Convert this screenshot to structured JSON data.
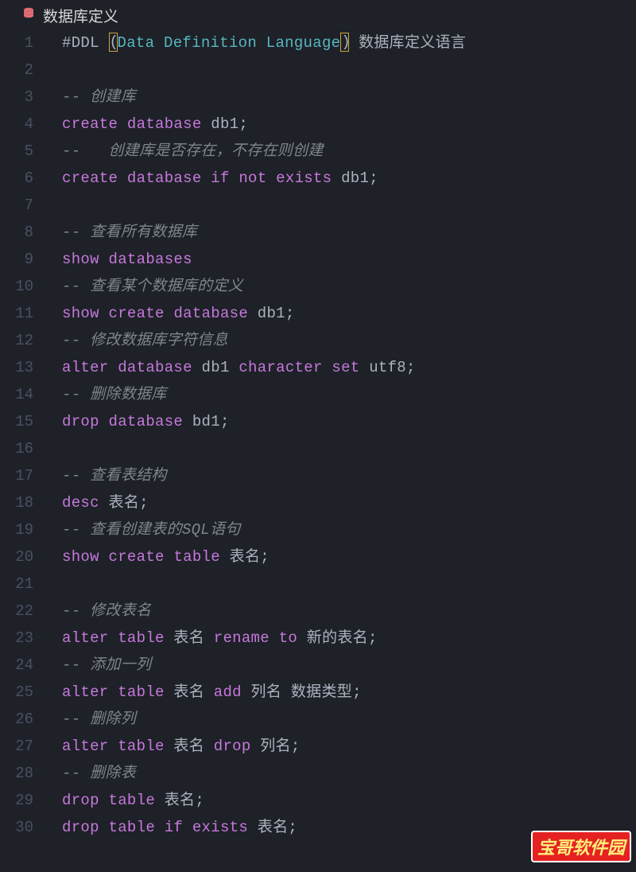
{
  "header": {
    "title": "数据库定义"
  },
  "watermark": "宝哥软件园",
  "colors": {
    "keyword": "#c678dd",
    "cyan": "#56b6c2",
    "comment": "#7f848e",
    "text": "#abb2bf",
    "bg": "#1e2127"
  },
  "lines": [
    {
      "n": 1,
      "tokens": [
        {
          "t": "#DDL ",
          "c": "txt"
        },
        {
          "t": "(",
          "c": "br-hl"
        },
        {
          "t": "Data Definition Language",
          "c": "fn"
        },
        {
          "t": ")",
          "c": "br-hl"
        },
        {
          "t": " ",
          "c": "txt"
        },
        {
          "t": "数据库定义语言",
          "c": "txt"
        }
      ]
    },
    {
      "n": 2,
      "tokens": []
    },
    {
      "n": 3,
      "tokens": [
        {
          "t": "-- ",
          "c": "cmt"
        },
        {
          "t": "创建库",
          "c": "cmt"
        }
      ]
    },
    {
      "n": 4,
      "tokens": [
        {
          "t": "create",
          "c": "k"
        },
        {
          "t": " ",
          "c": "txt"
        },
        {
          "t": "database",
          "c": "k"
        },
        {
          "t": " db1;",
          "c": "txt"
        }
      ]
    },
    {
      "n": 5,
      "tokens": [
        {
          "t": "--   创建库是否存在，不存在则创建",
          "c": "cmt"
        }
      ]
    },
    {
      "n": 6,
      "tokens": [
        {
          "t": "create",
          "c": "k"
        },
        {
          "t": " ",
          "c": "txt"
        },
        {
          "t": "database",
          "c": "k"
        },
        {
          "t": " ",
          "c": "txt"
        },
        {
          "t": "if",
          "c": "k"
        },
        {
          "t": " ",
          "c": "txt"
        },
        {
          "t": "not",
          "c": "k"
        },
        {
          "t": " ",
          "c": "txt"
        },
        {
          "t": "exists",
          "c": "k"
        },
        {
          "t": " db1;",
          "c": "txt"
        }
      ]
    },
    {
      "n": 7,
      "tokens": []
    },
    {
      "n": 8,
      "tokens": [
        {
          "t": "-- 查看所有数据库",
          "c": "cmt"
        }
      ]
    },
    {
      "n": 9,
      "tokens": [
        {
          "t": "show",
          "c": "k"
        },
        {
          "t": " ",
          "c": "txt"
        },
        {
          "t": "databases",
          "c": "k"
        }
      ]
    },
    {
      "n": 10,
      "tokens": [
        {
          "t": "-- 查看某个数据库的定义",
          "c": "cmt"
        }
      ]
    },
    {
      "n": 11,
      "tokens": [
        {
          "t": "show",
          "c": "k"
        },
        {
          "t": " ",
          "c": "txt"
        },
        {
          "t": "create",
          "c": "k"
        },
        {
          "t": " ",
          "c": "txt"
        },
        {
          "t": "database",
          "c": "k"
        },
        {
          "t": " db1;",
          "c": "txt"
        }
      ]
    },
    {
      "n": 12,
      "tokens": [
        {
          "t": "-- 修改数据库字符信息",
          "c": "cmt"
        }
      ]
    },
    {
      "n": 13,
      "tokens": [
        {
          "t": "alter",
          "c": "k"
        },
        {
          "t": " ",
          "c": "txt"
        },
        {
          "t": "database",
          "c": "k"
        },
        {
          "t": " db1 ",
          "c": "txt"
        },
        {
          "t": "character",
          "c": "k"
        },
        {
          "t": " ",
          "c": "txt"
        },
        {
          "t": "set",
          "c": "k"
        },
        {
          "t": " utf8;",
          "c": "txt"
        }
      ]
    },
    {
      "n": 14,
      "tokens": [
        {
          "t": "-- 删除数据库",
          "c": "cmt"
        }
      ]
    },
    {
      "n": 15,
      "tokens": [
        {
          "t": "drop",
          "c": "k"
        },
        {
          "t": " ",
          "c": "txt"
        },
        {
          "t": "database",
          "c": "k"
        },
        {
          "t": " bd1;",
          "c": "txt"
        }
      ]
    },
    {
      "n": 16,
      "tokens": []
    },
    {
      "n": 17,
      "tokens": [
        {
          "t": "-- 查看表结构",
          "c": "cmt"
        }
      ]
    },
    {
      "n": 18,
      "tokens": [
        {
          "t": "desc",
          "c": "k"
        },
        {
          "t": " 表名;",
          "c": "txt"
        }
      ]
    },
    {
      "n": 19,
      "tokens": [
        {
          "t": "-- 查看创建表的SQL语句",
          "c": "cmt"
        }
      ]
    },
    {
      "n": 20,
      "tokens": [
        {
          "t": "show",
          "c": "k"
        },
        {
          "t": " ",
          "c": "txt"
        },
        {
          "t": "create",
          "c": "k"
        },
        {
          "t": " ",
          "c": "txt"
        },
        {
          "t": "table",
          "c": "k"
        },
        {
          "t": " 表名;",
          "c": "txt"
        }
      ]
    },
    {
      "n": 21,
      "tokens": []
    },
    {
      "n": 22,
      "tokens": [
        {
          "t": "-- 修改表名",
          "c": "cmt"
        }
      ]
    },
    {
      "n": 23,
      "tokens": [
        {
          "t": "alter",
          "c": "k"
        },
        {
          "t": " ",
          "c": "txt"
        },
        {
          "t": "table",
          "c": "k"
        },
        {
          "t": " 表名 ",
          "c": "txt"
        },
        {
          "t": "rename",
          "c": "k"
        },
        {
          "t": " ",
          "c": "txt"
        },
        {
          "t": "to",
          "c": "k"
        },
        {
          "t": " 新的表名;",
          "c": "txt"
        }
      ]
    },
    {
      "n": 24,
      "tokens": [
        {
          "t": "-- 添加一列",
          "c": "cmt"
        }
      ]
    },
    {
      "n": 25,
      "tokens": [
        {
          "t": "alter",
          "c": "k"
        },
        {
          "t": " ",
          "c": "txt"
        },
        {
          "t": "table",
          "c": "k"
        },
        {
          "t": " 表名 ",
          "c": "txt"
        },
        {
          "t": "add",
          "c": "k"
        },
        {
          "t": " 列名 数据类型;",
          "c": "txt"
        }
      ]
    },
    {
      "n": 26,
      "tokens": [
        {
          "t": "-- 删除列",
          "c": "cmt"
        }
      ]
    },
    {
      "n": 27,
      "tokens": [
        {
          "t": "alter",
          "c": "k"
        },
        {
          "t": " ",
          "c": "txt"
        },
        {
          "t": "table",
          "c": "k"
        },
        {
          "t": " 表名 ",
          "c": "txt"
        },
        {
          "t": "drop",
          "c": "k"
        },
        {
          "t": " 列名;",
          "c": "txt"
        }
      ]
    },
    {
      "n": 28,
      "tokens": [
        {
          "t": "-- 删除表",
          "c": "cmt"
        }
      ]
    },
    {
      "n": 29,
      "tokens": [
        {
          "t": "drop",
          "c": "k"
        },
        {
          "t": " ",
          "c": "txt"
        },
        {
          "t": "table",
          "c": "k"
        },
        {
          "t": " 表名;",
          "c": "txt"
        }
      ]
    },
    {
      "n": 30,
      "tokens": [
        {
          "t": "drop",
          "c": "k"
        },
        {
          "t": " ",
          "c": "txt"
        },
        {
          "t": "table",
          "c": "k"
        },
        {
          "t": " ",
          "c": "txt"
        },
        {
          "t": "if",
          "c": "k"
        },
        {
          "t": " ",
          "c": "txt"
        },
        {
          "t": "exists",
          "c": "k"
        },
        {
          "t": " 表名;",
          "c": "txt"
        }
      ]
    }
  ]
}
